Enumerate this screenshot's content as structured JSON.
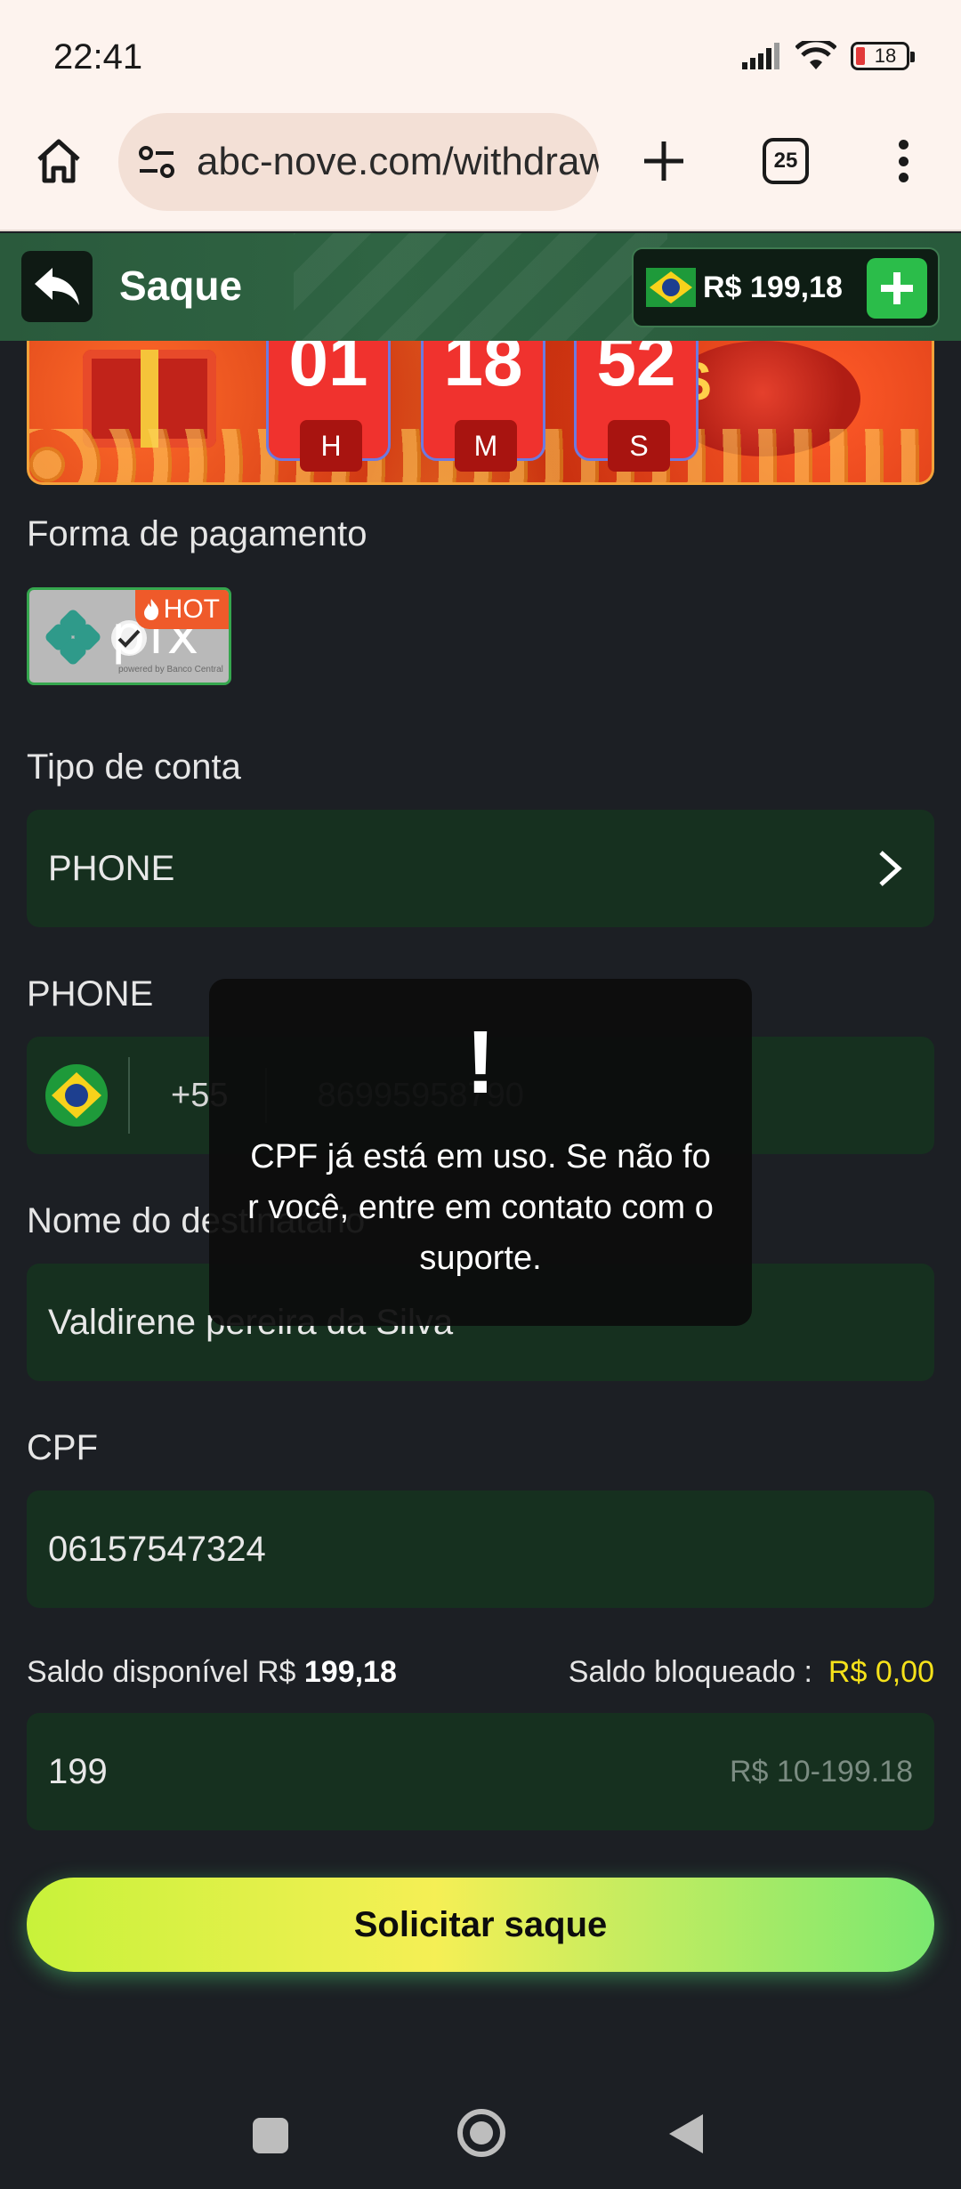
{
  "status_bar": {
    "time": "22:41",
    "battery": "18"
  },
  "browser": {
    "url": "abc-nove.com/withdraw",
    "tab_count": "25"
  },
  "header": {
    "title": "Saque",
    "balance": "R$ 199,18"
  },
  "banner": {
    "timer": [
      {
        "value": "01",
        "unit": "H"
      },
      {
        "value": "18",
        "unit": "M"
      },
      {
        "value": "52",
        "unit": "S"
      }
    ]
  },
  "payment": {
    "label": "Forma de pagamento",
    "method": "pix",
    "method_sub": "powered by Banco Central",
    "badge": "HOT"
  },
  "account_type": {
    "label": "Tipo de conta",
    "value": "PHONE"
  },
  "phone": {
    "label": "PHONE",
    "dial_code": "+55",
    "number": "86995958790"
  },
  "recipient": {
    "label": "Nome do destinatário",
    "value": "Valdirene pereira da Silva"
  },
  "cpf": {
    "label": "CPF",
    "value": "06157547324"
  },
  "balances": {
    "available_label": "Saldo disponível R$",
    "available_value": "199,18",
    "blocked_label": "Saldo bloqueado :",
    "blocked_value": "R$ 0,00"
  },
  "amount": {
    "value": "199",
    "range_hint": "R$ 10-199.18"
  },
  "submit": {
    "label": "Solicitar saque"
  },
  "toast": {
    "icon": "!",
    "message": "CPF já está em uso. Se não for você, entre em contato com o suporte."
  },
  "colors": {
    "accent_green": "#2bbd4a",
    "field_bg": "#16301f",
    "warning_yellow": "#f6e21a",
    "hot_orange": "#ef5a2a"
  }
}
